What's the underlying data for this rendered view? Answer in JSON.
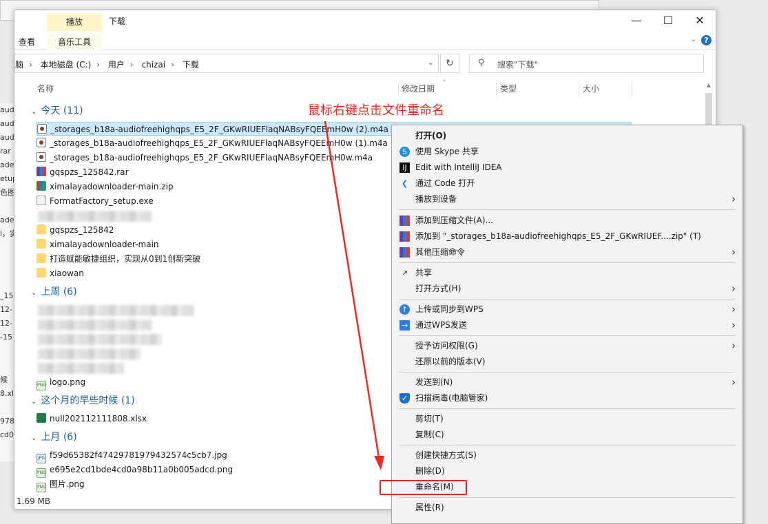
{
  "window": {
    "title": "下载",
    "ribbon_context_tab": "播放",
    "ribbon_tabs": [
      "查看",
      "音乐工具"
    ],
    "controls": [
      "minimize",
      "maximize",
      "close"
    ]
  },
  "breadcrumb": [
    "脑",
    "本地磁盘 (C:)",
    "用户",
    "chizai",
    "下载"
  ],
  "search_placeholder": "搜索\"下载\"",
  "columns": [
    "名称",
    "修改日期",
    "类型",
    "大小"
  ],
  "groups": [
    {
      "label": "今天 (11)"
    },
    {
      "label": "上周 (6)"
    },
    {
      "label": "这个月的早些时候 (1)"
    },
    {
      "label": "上月 (6)"
    }
  ],
  "files": {
    "today": [
      {
        "name": "_storages_b18a-audiofreehighqps_E5_2F_GKwRIUEFlaqNABsyFQEEmH0w (2).m4a",
        "icon": "m4a-icon"
      },
      {
        "name": "_storages_b18a-audiofreehighqps_E5_2F_GKwRIUEFlaqNABsyFQEEmH0w (1).m4a",
        "icon": "m4a-icon"
      },
      {
        "name": "_storages_b18a-audiofreehighqps_E5_2F_GKwRIUEFlaqNABsyFQEEmH0w.m4a",
        "icon": "m4a-icon"
      },
      {
        "name": "gqspzs_125842.rar",
        "icon": "rar-icon"
      },
      {
        "name": "ximalayadownloader-main.zip",
        "icon": "zip-icon"
      },
      {
        "name": "FormatFactory_setup.exe",
        "icon": "exe-icon"
      },
      {
        "name": "gqspzs_125842",
        "icon": "folder-icon"
      },
      {
        "name": "ximalayadownloader-main",
        "icon": "folder-icon"
      },
      {
        "name": "打造赋能敏捷组织，实现从0到1创新突破",
        "icon": "folder-icon"
      },
      {
        "name": "xiaowan",
        "icon": "folder-icon"
      }
    ],
    "last_week": [
      {
        "name": "logo.png",
        "icon": "png-icon"
      }
    ],
    "earlier_month": [
      {
        "name": "null202112111808.xlsx",
        "icon": "xlsx-icon"
      }
    ],
    "last_month": [
      {
        "name": "f59d65382f47429781979432574c5cb7.jpg",
        "icon": "jpg-icon"
      },
      {
        "name": "e695e2cd1bde4cd0a98b11a0b005adcd.png",
        "icon": "png-icon"
      },
      {
        "name": "图片.png",
        "icon": "png-icon"
      }
    ]
  },
  "status_text": "1.69 MB",
  "annotation": "鼠标右键点击文件重命名",
  "context_menu": [
    {
      "label": "打开(O)",
      "bold": true
    },
    {
      "label": "使用 Skype 共享",
      "icon": "skype-icon"
    },
    {
      "label": "Edit with IntelliJ IDEA",
      "icon": "intellij-icon"
    },
    {
      "label": "通过 Code 打开",
      "icon": "vscode-icon"
    },
    {
      "label": "播放到设备",
      "submenu": true
    },
    {
      "label": "添加到压缩文件(A)...",
      "icon": "archive-icon"
    },
    {
      "label": "添加到 \"_storages_b18a-audiofreehighqps_E5_2F_GKwRIUEF....zip\" (T)",
      "icon": "archive-icon"
    },
    {
      "label": "其他压缩命令",
      "icon": "archive-icon",
      "submenu": true
    },
    {
      "label": "共享",
      "icon": "share-icon"
    },
    {
      "label": "打开方式(H)",
      "submenu": true
    },
    {
      "label": "上传或同步到WPS",
      "icon": "wps-upload-icon",
      "submenu": true
    },
    {
      "label": "通过WPS发送",
      "icon": "wps-send-icon",
      "submenu": true
    },
    {
      "label": "授予访问权限(G)",
      "submenu": true
    },
    {
      "label": "还原以前的版本(V)"
    },
    {
      "label": "发送到(N)",
      "submenu": true
    },
    {
      "label": "扫描病毒(电脑管家)",
      "icon": "shield-icon"
    },
    {
      "label": "剪切(T)"
    },
    {
      "label": "复制(C)"
    },
    {
      "label": "创建快捷方式(S)"
    },
    {
      "label": "删除(D)"
    },
    {
      "label": "重命名(M)"
    },
    {
      "label": "属性(R)"
    }
  ],
  "bg_fragments": [
    "aud",
    "aud",
    "aud",
    "rar",
    "ade",
    "etup",
    "色图",
    "ade",
    "l，实",
    "_15",
    "12-",
    "12-",
    "-15",
    "候",
    "8.xl",
    "978",
    "cd0"
  ],
  "colors": {
    "accent": "#1b5fa8",
    "annotation": "#f02a1c",
    "selection": "#cce8ff"
  }
}
